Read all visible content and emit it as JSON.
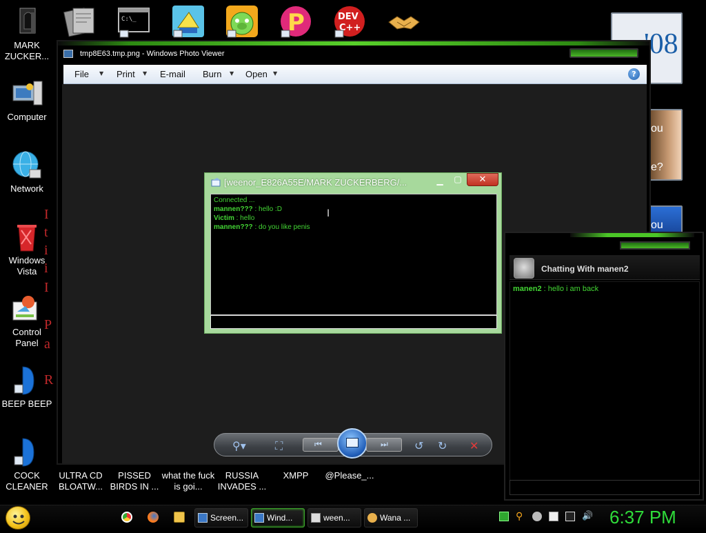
{
  "desktop": {
    "left_icons": [
      {
        "label": "MARK ZUCKER..."
      },
      {
        "label": "Computer"
      },
      {
        "label": "Network"
      },
      {
        "label": "Windows Vista"
      },
      {
        "label": "Control Panel"
      },
      {
        "label": "BEEP BEEP"
      },
      {
        "label": "COCK CLEANER"
      }
    ],
    "red_letters": [
      "I",
      "t",
      "i",
      "i",
      "I",
      "P",
      "a",
      "R"
    ],
    "bottom_labels": [
      "ULTRA CD BLOATW...",
      "PISSED BIRDS IN ...",
      "what the fuck is goi...",
      "RUSSIA INVADES ...",
      "XMPP",
      "@Please_..."
    ],
    "top_icons": [
      "document-icon",
      "cmd-icon",
      "window-icon",
      "pig-icon",
      "p-icon",
      "devcpp-icon",
      "handshake-icon"
    ],
    "devcpp_text": "DEV C++"
  },
  "photo_viewer": {
    "title": "tmp8E63.tmp.png - Windows Photo Viewer",
    "menu": [
      "File",
      "Print",
      "E-mail",
      "Burn",
      "Open"
    ],
    "help": "?"
  },
  "chat_dialog": {
    "title": "[weenor_E826A55E/MARK ZUCKERBERG/...",
    "status": "Connected ...",
    "messages": [
      {
        "sender": "mannen???",
        "text": " : hello :D"
      },
      {
        "sender": "Victim",
        "text": " : hello"
      },
      {
        "sender": "mannen???",
        "text": " : do you like penis"
      }
    ]
  },
  "right_chat": {
    "title": "Chatting With manen2",
    "message": {
      "sender": "manen2",
      "text": " : hello i am back"
    }
  },
  "side_panels": {
    "one": "'08",
    "two_a": "ou",
    "two_b": "e?",
    "three": "ou"
  },
  "taskbar": {
    "buttons": [
      "Screen...",
      "Wind...",
      "ween...",
      "Wana ..."
    ],
    "clock": "6:37 PM"
  }
}
